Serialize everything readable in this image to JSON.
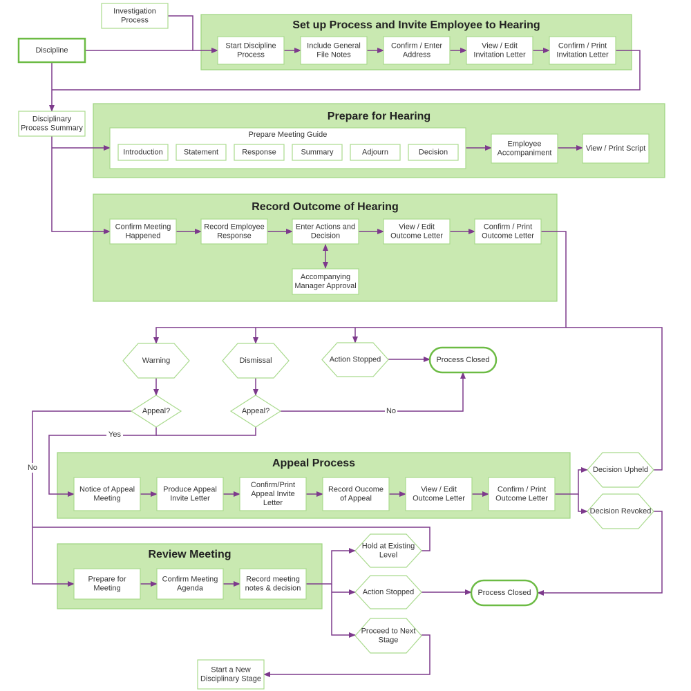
{
  "colors": {
    "group_fill": "#c9e9b1",
    "group_border": "#9dd47f",
    "box_border": "#a9da8d",
    "terminal_border": "#6cbb44",
    "connector": "#7d3a8c"
  },
  "groups": {
    "setup": "Set up Process and Invite Employee to Hearing",
    "prepare": "Prepare for Hearing",
    "record": "Record Outcome of Hearing",
    "appeal": "Appeal Process",
    "review": "Review Meeting"
  },
  "nodes": {
    "investigation": "Investigation\nProcess",
    "discipline": "Discipline",
    "summary": "Disciplinary\nProcess Summary",
    "start": "Start Discipline\nProcess",
    "notes": "Include General\nFile Notes",
    "address": "Confirm / Enter\nAddress",
    "view_invite": "View / Edit\nInvitation Letter",
    "print_invite": "Confirm / Print\nInvitation Letter",
    "guide": "Prepare Meeting Guide",
    "intro": "Introduction",
    "statement": "Statement",
    "response": "Response",
    "summary_item": "Summary",
    "adjourn": "Adjourn",
    "decision": "Decision",
    "accompaniment": "Employee\nAccompaniment",
    "script": "View / Print Script",
    "confirm_meeting": "Confirm Meeting\nHappened",
    "emp_response": "Record Employee\nResponse",
    "actions": "Enter Actions and\nDecision",
    "view_outcome": "View / Edit\nOutcome Letter",
    "print_outcome": "Confirm / Print\nOutcome Letter",
    "manager": "Accompanying\nManager Approval",
    "warning": "Warning",
    "dismissal": "Dismissal",
    "action_stopped": "Action Stopped",
    "closed1": "Process Closed",
    "appeal1": "Appeal?",
    "appeal2": "Appeal?",
    "notice": "Notice of Appeal\nMeeting",
    "produce": "Produce Appeal\nInvite Letter",
    "print_appeal": "Confirm/Print\nAppeal Invite\nLetter",
    "record_appeal": "Record Oucome\nof Appeal",
    "view_outcome2": "View / Edit\nOutcome Letter",
    "print_outcome2": "Confirm / Print\nOutcome Letter",
    "upheld": "Decision Upheld",
    "revoked": "Decision Revoked",
    "prep_meeting": "Prepare for\nMeeting",
    "agenda": "Confirm Meeting\nAgenda",
    "notes_decision": "Record meeting\nnotes & decision",
    "hold": "Hold at Existing\nLevel",
    "action_stopped2": "Action Stopped",
    "proceed": "Proceed to Next\nStage",
    "closed2": "Process Closed",
    "new_stage": "Start a New\nDisciplinary Stage"
  },
  "edge_labels": {
    "yes": "Yes",
    "no_left": "No",
    "no_right": "No"
  }
}
